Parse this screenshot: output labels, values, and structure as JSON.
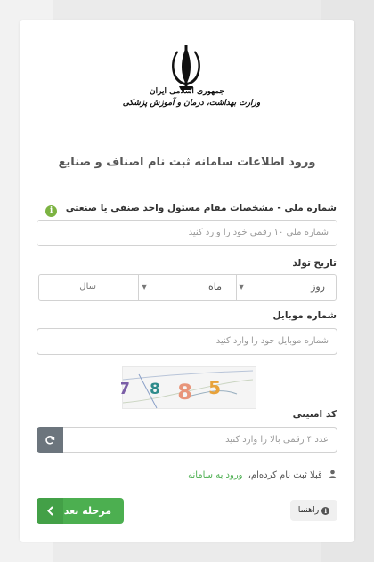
{
  "logo": {
    "line1": "جمهوری اسلامی ایران",
    "line2": "وزارت بهداشت، درمان و آموزش پزشکی"
  },
  "page_title": "ورود اطلاعات سامانه ثبت نام اصناف و صنایع",
  "national_id": {
    "label": "شماره ملی - مشخصات مقام مسئول واحد صنفی یا صنعتی",
    "placeholder": "شماره ملی ۱۰ رقمی خود را وارد کنید"
  },
  "birth_date": {
    "label": "تاریخ تولد",
    "day": "روز",
    "month": "ماه",
    "year": "سال"
  },
  "mobile": {
    "label": "شماره موبایل",
    "placeholder": "شماره موبایل خود را وارد کنید"
  },
  "captcha": {
    "digits": [
      "7",
      "8",
      "8",
      "5"
    ],
    "colors": [
      "#7b5ea7",
      "#2e8b8b",
      "#e8957a",
      "#e8a23a"
    ]
  },
  "security_code": {
    "label": "کد امنیتی",
    "placeholder": "عدد ۴ رقمی بالا را وارد کنید"
  },
  "already_registered": {
    "text": "قبلا ثبت نام کرده‌ام،",
    "link": "ورود به سامانه"
  },
  "buttons": {
    "next": "مرحله بعد",
    "help": "راهنما"
  },
  "colors": {
    "primary_green": "#4caf50",
    "refresh_gray": "#6c757d"
  }
}
